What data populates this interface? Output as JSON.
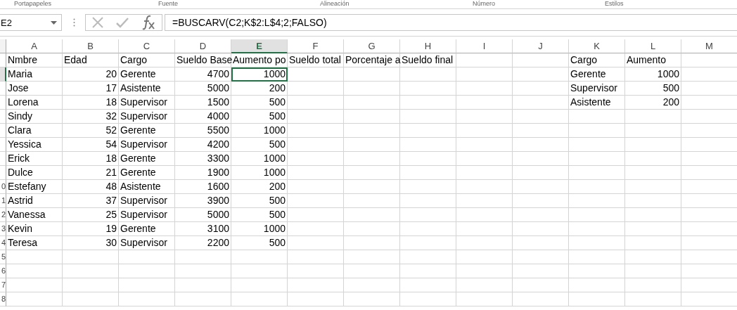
{
  "ribbon_groups": [
    "Portapapeles",
    "Fuente",
    "Alineación",
    "Número",
    "Estilos"
  ],
  "name_box": "E2",
  "formula": "=BUSCARV(C2;K$2:L$4;2;FALSO)",
  "columns": [
    {
      "label": "A",
      "selected": false
    },
    {
      "label": "B",
      "selected": false
    },
    {
      "label": "C",
      "selected": false
    },
    {
      "label": "D",
      "selected": false
    },
    {
      "label": "E",
      "selected": true
    },
    {
      "label": "F",
      "selected": false
    },
    {
      "label": "G",
      "selected": false
    },
    {
      "label": "H",
      "selected": false
    },
    {
      "label": "I",
      "selected": false
    },
    {
      "label": "J",
      "selected": false
    },
    {
      "label": "K",
      "selected": false
    },
    {
      "label": "L",
      "selected": false
    },
    {
      "label": "M",
      "selected": false
    }
  ],
  "table": {
    "headers": [
      "Nmbre",
      "Edad",
      "Cargo",
      "Sueldo Base",
      "Aumento po",
      "Sueldo total",
      "Porcentaje a",
      "Sueldo final"
    ],
    "numeric": [
      false,
      true,
      false,
      true,
      true,
      true,
      true,
      true
    ],
    "rows": [
      {
        "cells": [
          "Maria",
          "20",
          "Gerente",
          "4700",
          "1000"
        ],
        "selected": true
      },
      {
        "cells": [
          "Jose",
          "17",
          "Asistente",
          "5000",
          "200"
        ],
        "selected": false
      },
      {
        "cells": [
          "Lorena",
          "18",
          "Supervisor",
          "1500",
          "500"
        ],
        "selected": false
      },
      {
        "cells": [
          "Sindy",
          "32",
          "Supervisor",
          "4000",
          "500"
        ],
        "selected": false
      },
      {
        "cells": [
          "Clara",
          "52",
          "Gerente",
          "5500",
          "1000"
        ],
        "selected": false
      },
      {
        "cells": [
          "Yessica",
          "54",
          "Supervisor",
          "4200",
          "500"
        ],
        "selected": false
      },
      {
        "cells": [
          "Erick",
          "18",
          "Gerente",
          "3300",
          "1000"
        ],
        "selected": false
      },
      {
        "cells": [
          "Dulce",
          "21",
          "Gerente",
          "1900",
          "1000"
        ],
        "selected": false
      },
      {
        "cells": [
          "Estefany",
          "48",
          "Asistente",
          "1600",
          "200"
        ],
        "selected": false,
        "row_label": "0"
      },
      {
        "cells": [
          "Astrid",
          "37",
          "Supervisor",
          "3900",
          "500"
        ],
        "selected": false,
        "row_label": "1"
      },
      {
        "cells": [
          "Vanessa",
          "25",
          "Supervisor",
          "5000",
          "500"
        ],
        "selected": false,
        "row_label": "2"
      },
      {
        "cells": [
          "Kevin",
          "19",
          "Gerente",
          "3100",
          "1000"
        ],
        "selected": false,
        "row_label": "3"
      },
      {
        "cells": [
          "Teresa",
          "30",
          "Supervisor",
          "2200",
          "500"
        ],
        "selected": false,
        "row_label": "4"
      }
    ]
  },
  "empty_row_labels": [
    "5",
    "6",
    "7",
    "8"
  ],
  "lookup": {
    "headers": [
      "Cargo",
      "Aumento"
    ],
    "numeric": [
      false,
      true
    ],
    "rows": [
      [
        "Gerente",
        "1000"
      ],
      [
        "Supervisor",
        "500"
      ],
      [
        "Asistente",
        "200"
      ]
    ]
  }
}
